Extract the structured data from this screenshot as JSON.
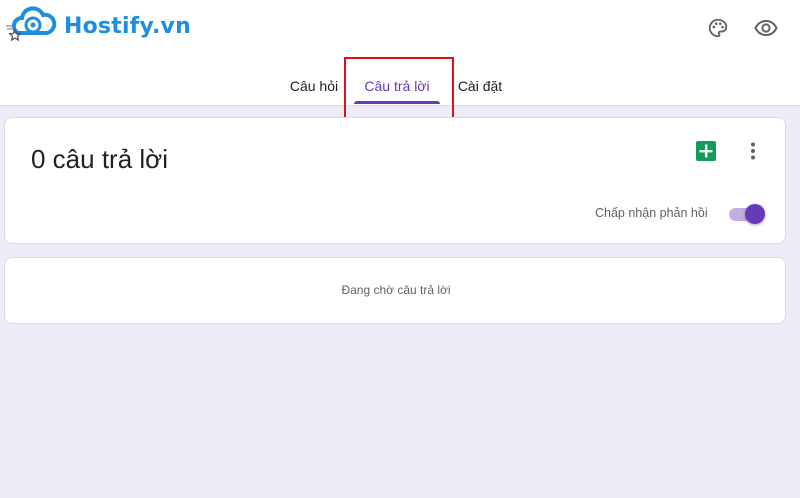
{
  "brand": {
    "logo_text": "Hostify.vn",
    "accent_color": "#1d8fdc"
  },
  "header": {
    "icons": [
      "palette-icon",
      "eye-icon"
    ]
  },
  "tabs": [
    {
      "label": "Câu hỏi",
      "active": false
    },
    {
      "label": "Câu trả lời",
      "active": true
    },
    {
      "label": "Cài đặt",
      "active": false
    }
  ],
  "responses": {
    "count_title": "0 câu trả lời",
    "accept_label": "Chấp nhận phản hồi",
    "accepting": true,
    "waiting_text": "Đang chờ câu trả lời"
  },
  "colors": {
    "primary": "#673ab7",
    "background": "#f0ebf8",
    "sheets_green": "#0f9d58",
    "highlight_red": "#e0101a"
  }
}
